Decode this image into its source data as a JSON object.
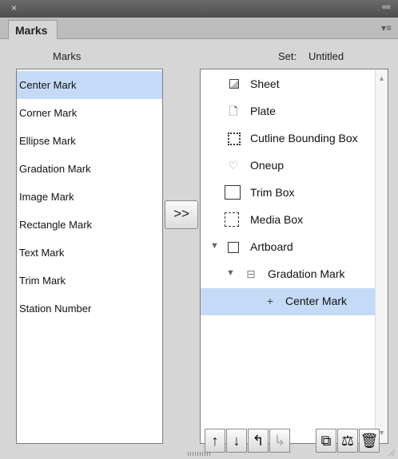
{
  "window": {
    "close_glyph": "×",
    "collapse_glyph": "««"
  },
  "tabs": [
    {
      "label": "Marks"
    }
  ],
  "panel_menu_glyph": "▾≡",
  "left": {
    "header": "Marks",
    "items": [
      {
        "label": "Center Mark",
        "selected": true
      },
      {
        "label": "Corner Mark"
      },
      {
        "label": "Ellipse Mark"
      },
      {
        "label": "Gradation Mark"
      },
      {
        "label": "Image Mark"
      },
      {
        "label": "Rectangle Mark"
      },
      {
        "label": "Text Mark"
      },
      {
        "label": "Trim Mark"
      },
      {
        "label": "Station Number"
      }
    ]
  },
  "add_button": {
    "label": ">>"
  },
  "right": {
    "set_label": "Set:",
    "set_value": "Untitled",
    "tree": [
      {
        "label": "Sheet",
        "icon": "sheet-icon"
      },
      {
        "label": "Plate",
        "icon": "plate-icon",
        "glyph": "🗋"
      },
      {
        "label": "Cutline Bounding Box",
        "icon": "cutline-bounding-box-icon"
      },
      {
        "label": "Oneup",
        "icon": "oneup-icon",
        "glyph": "♡"
      },
      {
        "label": "Trim Box",
        "icon": "trim-box-icon"
      },
      {
        "label": "Media Box",
        "icon": "media-box-icon"
      },
      {
        "label": "Artboard",
        "icon": "artboard-icon",
        "twisty": "▼"
      },
      {
        "label": "Gradation Mark",
        "icon": "gradation-mark-icon",
        "glyph": "⊟",
        "twisty": "▼"
      },
      {
        "label": "Center Mark",
        "icon": "center-mark-icon",
        "glyph": "+",
        "selected": true
      }
    ]
  },
  "scroll": {
    "up": "▲",
    "down": "▼"
  },
  "toolbar": [
    {
      "name": "move-up",
      "glyph": "↑"
    },
    {
      "name": "move-down",
      "glyph": "↓"
    },
    {
      "name": "move-out",
      "glyph": "↰"
    },
    {
      "name": "move-in",
      "glyph": "↳",
      "disabled": true
    },
    {
      "name": "duplicate",
      "glyph": "⧉"
    },
    {
      "name": "properties",
      "glyph": "⚖"
    },
    {
      "name": "delete",
      "glyph": "🗑"
    }
  ]
}
